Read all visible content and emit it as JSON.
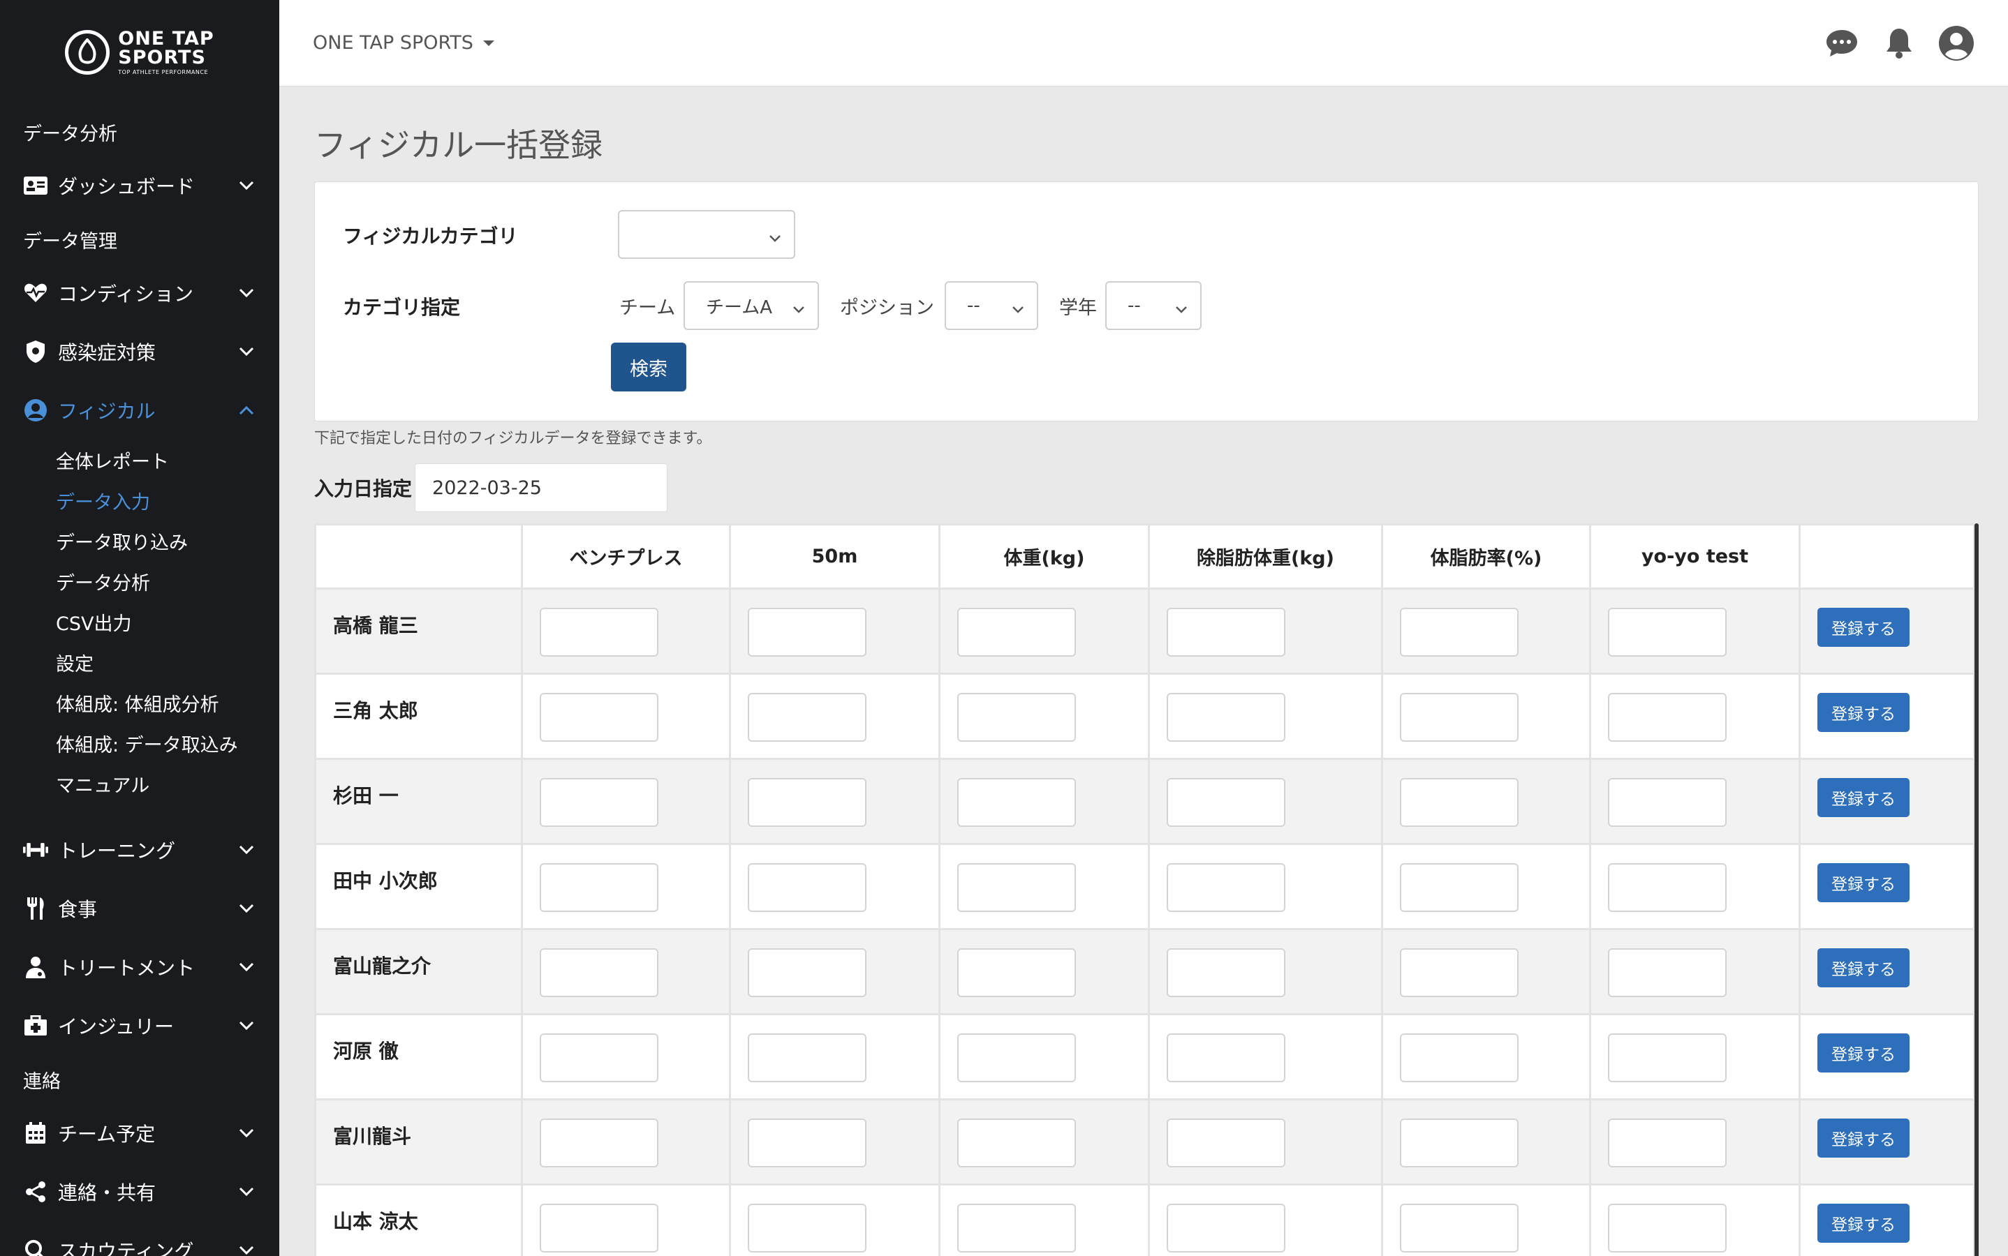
{
  "sidebar": {
    "logo_line1": "ONE TAP",
    "logo_line2": "SPORTS",
    "logo_tagline": "TOP ATHLETE PERFORMANCE",
    "section_data_analysis": "データ分析",
    "dashboard": "ダッシュボード",
    "section_data_management": "データ管理",
    "condition": "コンディション",
    "infection": "感染症対策",
    "physical": "フィジカル",
    "sub_items": [
      "全体レポート",
      "データ入力",
      "データ取り込み",
      "データ分析",
      "CSV出力",
      "設定",
      "体組成: 体組成分析",
      "体組成: データ取込み",
      "マニュアル"
    ],
    "training": "トレーニング",
    "meal": "食事",
    "treatment": "トリートメント",
    "injury": "インジュリー",
    "section_contact": "連絡",
    "team_schedule": "チーム予定",
    "share": "連絡・共有",
    "scouting": "スカウティング"
  },
  "topbar": {
    "brand": "ONE TAP SPORTS"
  },
  "page": {
    "title": "フィジカル一括登録",
    "category_label": "フィジカルカテゴリ",
    "category_value": "",
    "filter_label": "カテゴリ指定",
    "team_label": "チーム",
    "team_value": "チームA",
    "position_label": "ポジション",
    "position_value": "--",
    "grade_label": "学年",
    "grade_value": "--",
    "search_button": "検索",
    "helper_text": "下記で指定した日付のフィジカルデータを登録できます。",
    "date_label": "入力日指定",
    "date_value": "2022-03-25"
  },
  "table": {
    "columns": [
      "",
      "ベンチプレス",
      "50m",
      "体重(kg)",
      "除脂肪体重(kg)",
      "体脂肪率(%)",
      "yo-yo test",
      ""
    ],
    "rows": [
      "高橋 龍三",
      "三角 太郎",
      "杉田 一",
      "田中 小次郎",
      "富山龍之介",
      "河原 徹",
      "富川龍斗",
      "山本 涼太"
    ],
    "register_label": "登録する"
  }
}
